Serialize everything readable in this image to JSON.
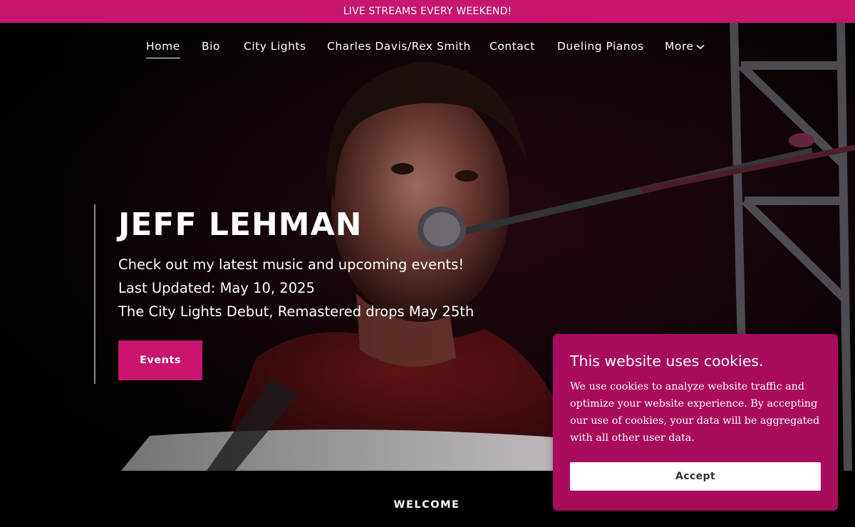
{
  "banner": {
    "text": "LIVE STREAMS EVERY WEEKEND!"
  },
  "nav": {
    "items": [
      {
        "label": "Home",
        "active": true
      },
      {
        "label": "Bio"
      },
      {
        "label": "City Lights"
      },
      {
        "label": "Charles Davis/Rex Smith"
      },
      {
        "label": "Contact"
      },
      {
        "label": "Dueling Pianos"
      },
      {
        "label": "More",
        "icon": "chevron-down-icon"
      }
    ]
  },
  "hero": {
    "title": "JEFF LEHMAN",
    "lines": [
      "Check out my latest music and upcoming events!",
      "Last Updated:  May 10, 2025",
      "The City Lights Debut, Remastered drops May 25th"
    ],
    "button_label": "Events",
    "image": "performer-singing-at-microphone-photo"
  },
  "welcome": {
    "title": "WELCOME"
  },
  "cookie": {
    "title": "This website uses cookies.",
    "body": "We use cookies to analyze website traffic and optimize your website experience. By accepting our use of cookies, your data will be aggregated with all other user data.",
    "accept_label": "Accept"
  },
  "colors": {
    "accent": "#c8156d",
    "cookie_bg": "#a90c5d",
    "background": "#000000",
    "text": "#ffffff"
  }
}
